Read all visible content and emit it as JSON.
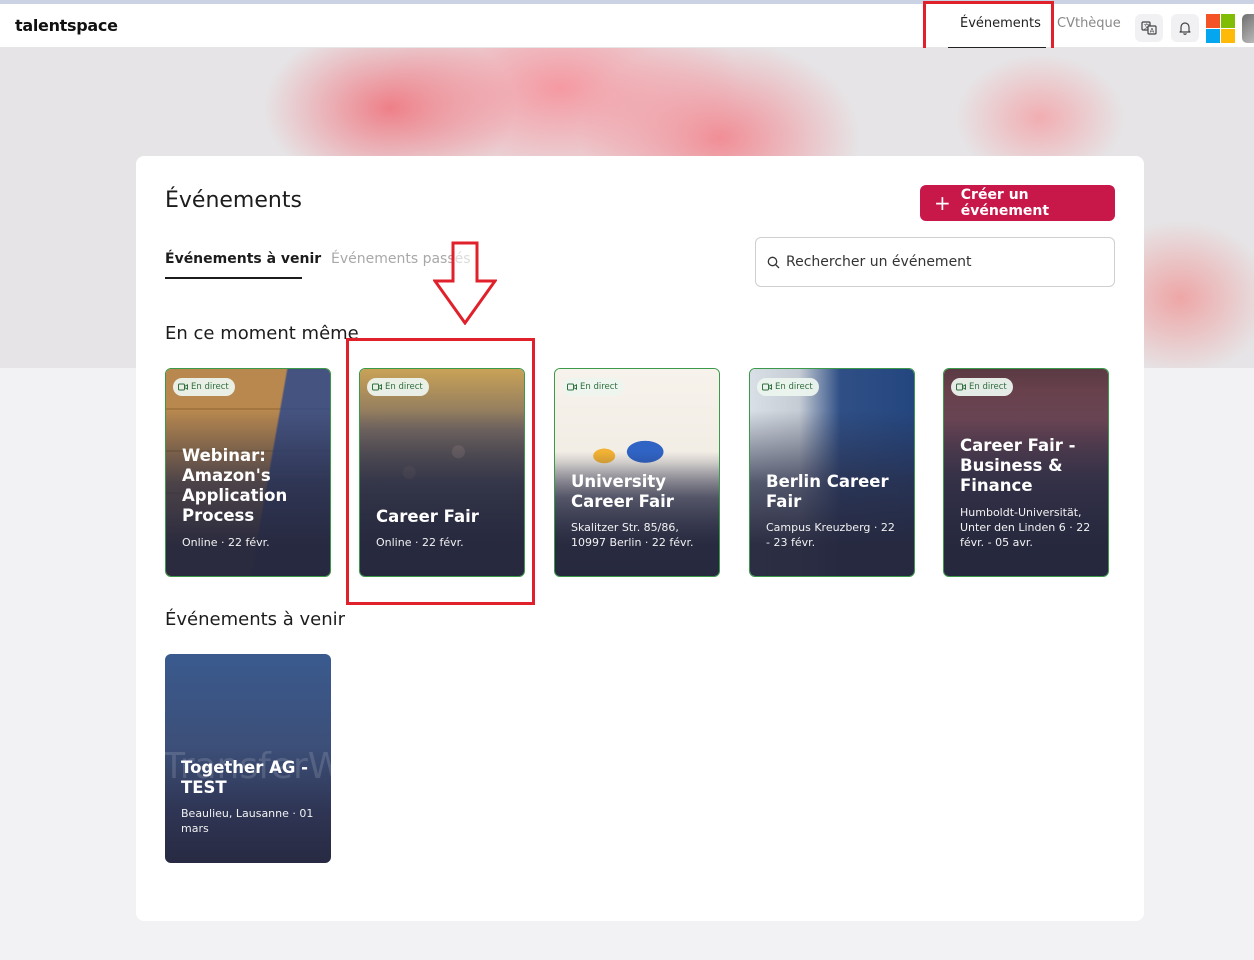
{
  "navbar": {
    "logo": "talentspace",
    "links": [
      {
        "label": "Événements",
        "active": true
      },
      {
        "label": "CVthèque",
        "active": false
      }
    ],
    "icons": [
      "translate-icon",
      "bell-icon",
      "microsoft-logo",
      "avatar"
    ]
  },
  "page": {
    "title": "Événements",
    "create_button": "Créer un événement",
    "tabs": [
      {
        "label": "Événements à venir",
        "active": true
      },
      {
        "label": "Événements passés",
        "active": false
      }
    ],
    "search_placeholder": "Rechercher un événement"
  },
  "sections": {
    "live_title": "En ce moment même",
    "upcoming_title": "Événements à venir"
  },
  "live_badge": "En direct",
  "live_events": [
    {
      "title": "Webinar: Amazon's Application Process",
      "meta": "Online · 22 févr."
    },
    {
      "title": "Career Fair",
      "meta": "Online · 22 févr."
    },
    {
      "title": "University Career Fair",
      "meta": "Skalitzer Str. 85/86, 10997 Berlin · 22 févr."
    },
    {
      "title": "Berlin Career Fair",
      "meta": "Campus Kreuzberg · 22 - 23 févr."
    },
    {
      "title": "Career Fair - Business & Finance",
      "meta": "Humboldt-Universität, Unter den Linden 6 · 22 févr. - 05 avr."
    }
  ],
  "upcoming_events": [
    {
      "title": "Together AG - TEST",
      "meta": "Beaulieu, Lausanne · 01 mars",
      "watermark": "TransferW"
    }
  ],
  "colors": {
    "accent": "#c8184a",
    "live_border": "#3a9a4a",
    "annotation": "#e0202a"
  }
}
